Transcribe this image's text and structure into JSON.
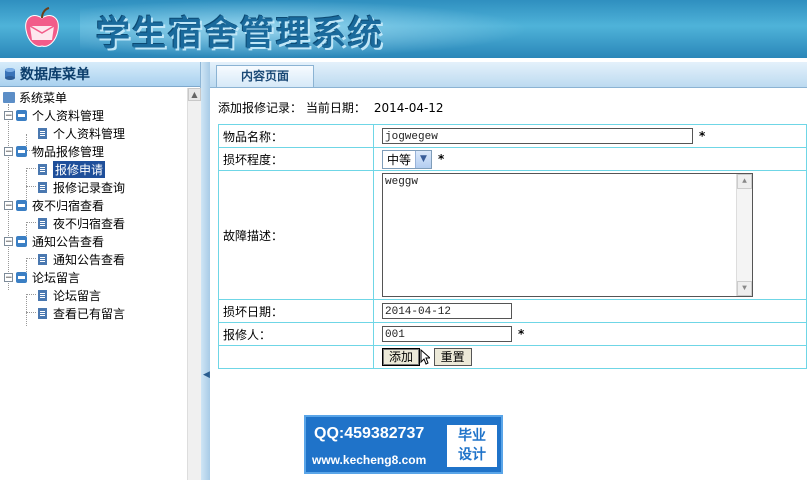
{
  "header": {
    "title": "学生宿舍管理系统"
  },
  "sidebar": {
    "title": "数据库菜单",
    "root": "系统菜单",
    "groups": [
      {
        "label": "个人资料管理",
        "items": [
          "个人资料管理"
        ]
      },
      {
        "label": "物品报修管理",
        "items": [
          "报修申请",
          "报修记录查询"
        ]
      },
      {
        "label": "夜不归宿查看",
        "items": [
          "夜不归宿查看"
        ]
      },
      {
        "label": "通知公告查看",
        "items": [
          "通知公告查看"
        ]
      },
      {
        "label": "论坛留言",
        "items": [
          "论坛留言",
          "查看已有留言"
        ]
      }
    ],
    "toggle_symbol": "−",
    "selected": "报修申请"
  },
  "content": {
    "tab": "内容页面",
    "crumb_label": "添加报修记录： 当前日期：",
    "current_date": "2014-04-12",
    "form": {
      "item_name_label": "物品名称：",
      "item_name_value": "jogwegew",
      "damage_level_label": "损坏程度：",
      "damage_level_value": "中等",
      "fault_desc_label": "故障描述：",
      "fault_desc_value": "weggw",
      "damage_date_label": "损坏日期：",
      "damage_date_value": "2014-04-12",
      "reporter_label": "报修人：",
      "reporter_value": "001",
      "required_mark": "*",
      "add_button": "添加",
      "reset_button": "重置"
    }
  },
  "watermark": {
    "qq": "QQ:459382737",
    "url": "www.kecheng8.com",
    "badge_line1": "毕业",
    "badge_line2": "设计"
  },
  "colors": {
    "accent": "#2f8fbf",
    "table_border": "#6fd6e6",
    "selection": "#1f4f9a"
  }
}
